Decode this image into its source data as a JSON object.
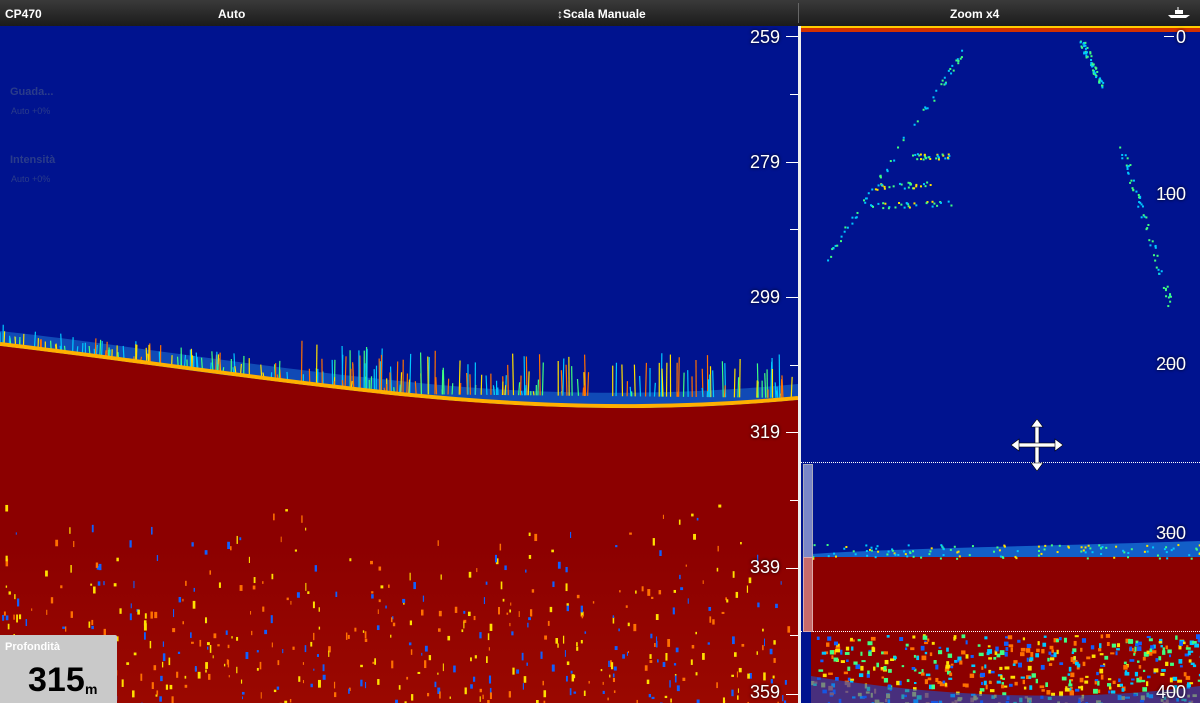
{
  "header": {
    "source": "CP470",
    "mode": "Auto",
    "scale_mode": "↕Scala Manuale",
    "zoom": "Zoom x4",
    "boat_icon": "boat-icon"
  },
  "left_scale": [
    "259",
    "279",
    "299",
    "319",
    "339",
    "359"
  ],
  "right_scale": [
    "0",
    "100",
    "200",
    "300",
    "400"
  ],
  "overlay_menu": {
    "gain_label": "Guada...",
    "gain_value": "Auto +0%",
    "intensity_label": "Intensità",
    "intensity_value": "Auto +0%"
  },
  "depth": {
    "label": "Profondità",
    "value": "315",
    "unit": "m"
  },
  "colors": {
    "water": "#00138f",
    "bottom": "#8c0000",
    "divider": "#eeeeee"
  },
  "icons": {
    "cursor": "move-cursor-icon"
  }
}
